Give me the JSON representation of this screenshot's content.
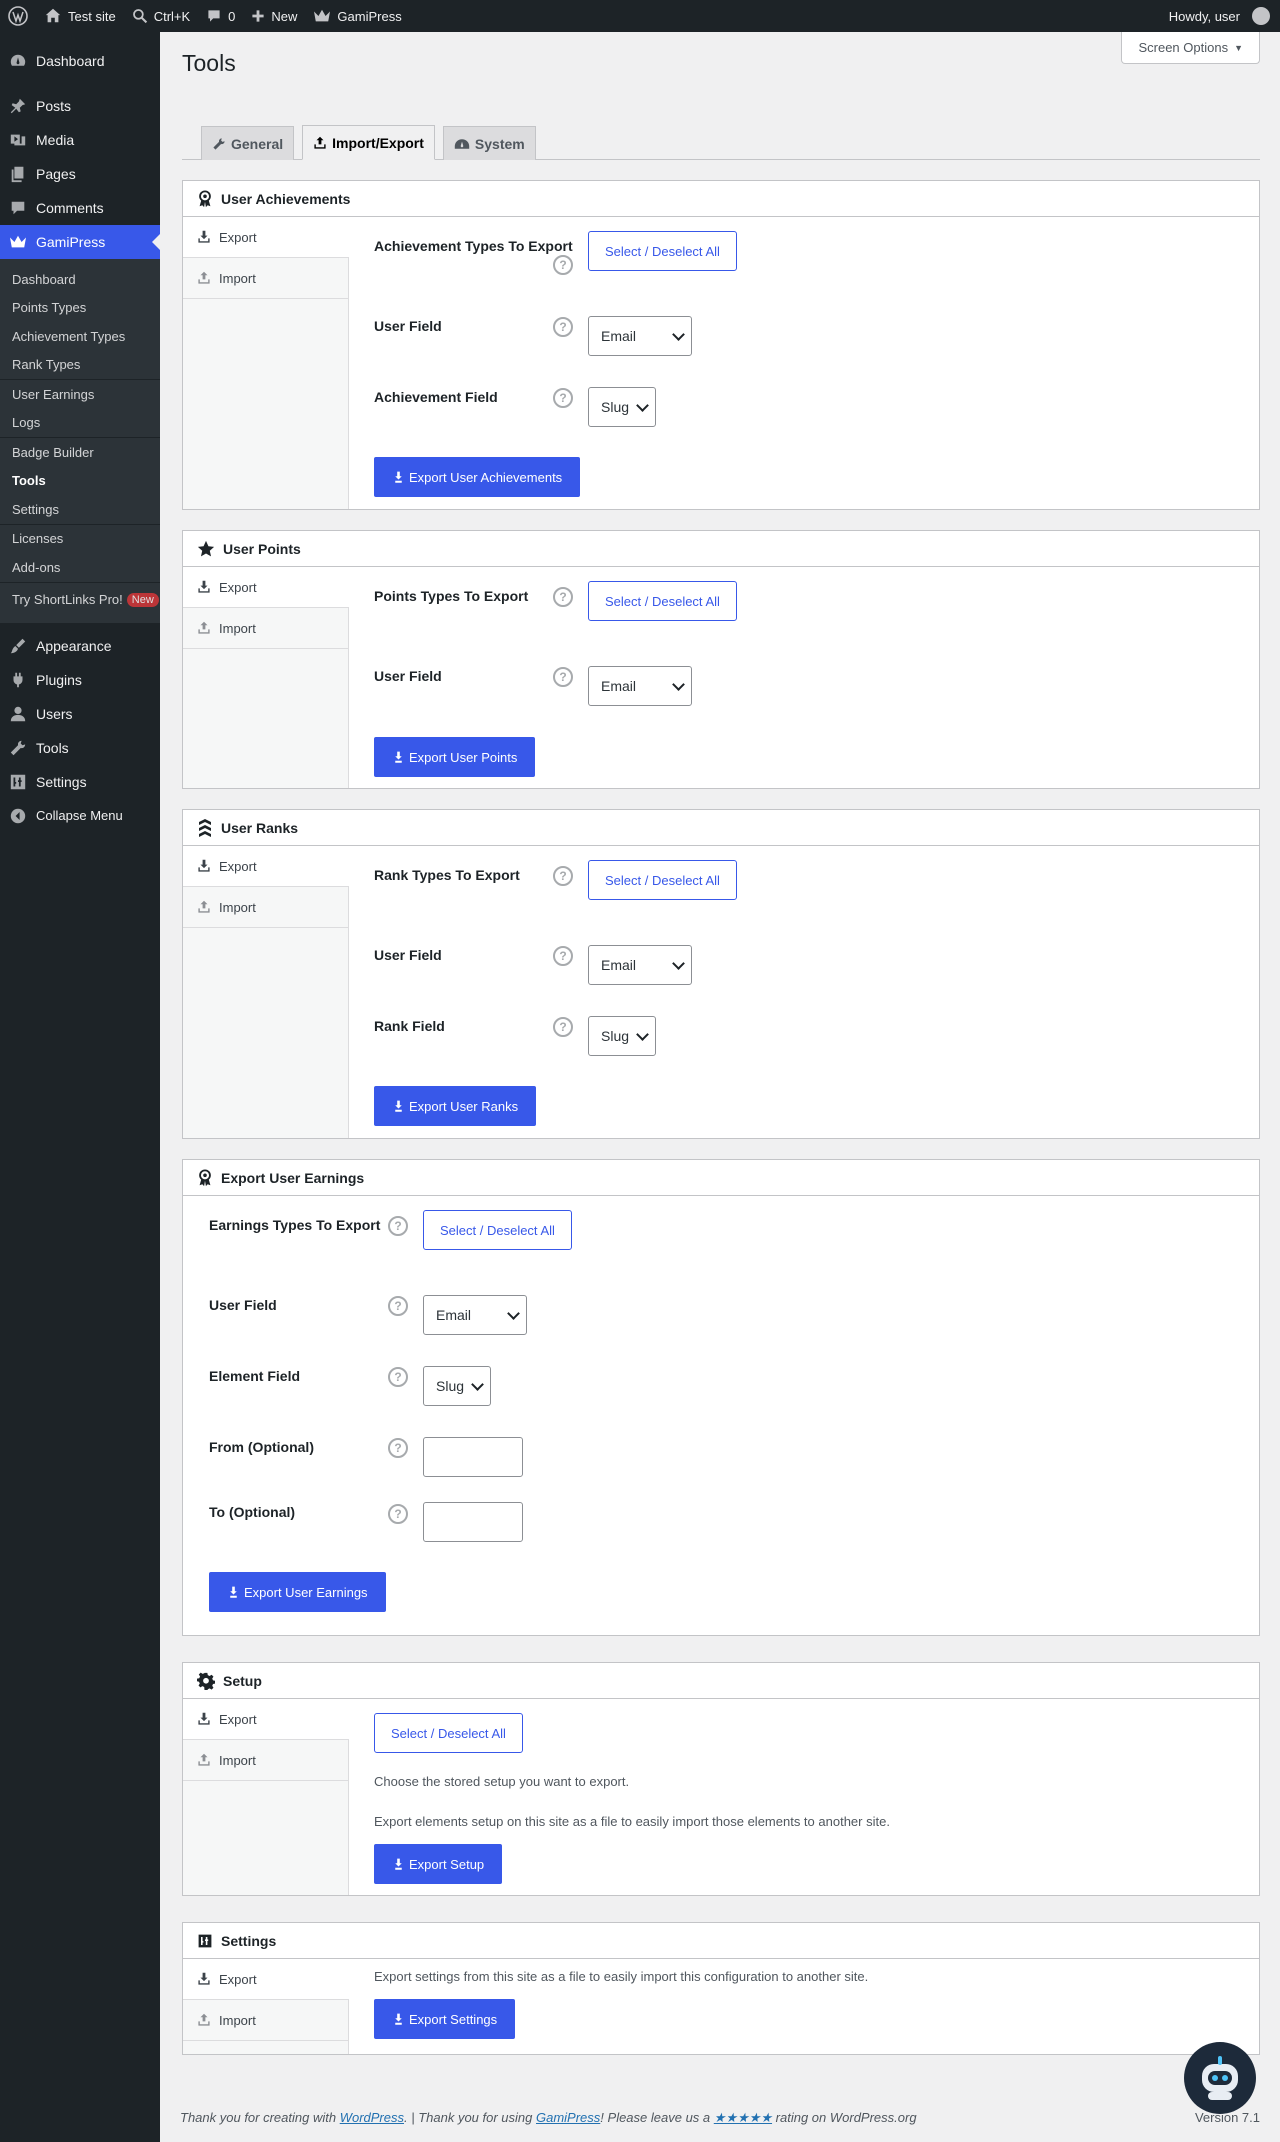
{
  "admin_bar": {
    "site_name": "Test site",
    "search_shortcut": "Ctrl+K",
    "comments_count": "0",
    "new_label": "New",
    "plugin_label": "GamiPress",
    "greeting": "Howdy, user"
  },
  "sidebar": {
    "dashboard": "Dashboard",
    "posts": "Posts",
    "media": "Media",
    "pages": "Pages",
    "comments": "Comments",
    "gamipress": "GamiPress",
    "gamipress_sub": {
      "dashboard": "Dashboard",
      "points_types": "Points Types",
      "achievement_types": "Achievement Types",
      "rank_types": "Rank Types",
      "user_earnings": "User Earnings",
      "logs": "Logs",
      "badge_builder": "Badge Builder",
      "tools": "Tools",
      "settings": "Settings",
      "licenses": "Licenses",
      "add_ons": "Add-ons",
      "try_shortlinks": "Try ShortLinks Pro!",
      "new_badge": "New"
    },
    "appearance": "Appearance",
    "plugins": "Plugins",
    "users": "Users",
    "tools": "Tools",
    "settings": "Settings",
    "collapse": "Collapse Menu"
  },
  "page": {
    "title": "Tools",
    "screen_options": "Screen Options"
  },
  "tabs": [
    "General",
    "Import/Export",
    "System"
  ],
  "common": {
    "export": "Export",
    "import": "Import",
    "select_deselect": "Select / Deselect All",
    "email": "Email",
    "slug": "Slug",
    "help": "?"
  },
  "user_achievements": {
    "title": "User Achievements",
    "types_label": "Achievement Types To Export",
    "user_field": "User Field",
    "achievement_field": "Achievement Field",
    "button": "Export User Achievements"
  },
  "user_points": {
    "title": "User Points",
    "types_label": "Points Types To Export",
    "user_field": "User Field",
    "button": "Export User Points"
  },
  "user_ranks": {
    "title": "User Ranks",
    "types_label": "Rank Types To Export",
    "user_field": "User Field",
    "rank_field": "Rank Field",
    "button": "Export User Ranks"
  },
  "user_earnings": {
    "title": "Export User Earnings",
    "types_label": "Earnings Types To Export",
    "user_field": "User Field",
    "element_field": "Element Field",
    "from": "From (Optional)",
    "to": "To (Optional)",
    "button": "Export User Earnings"
  },
  "setup": {
    "title": "Setup",
    "choose_text": "Choose the stored setup you want to export.",
    "desc": "Export elements setup on this site as a file to easily import those elements to another site.",
    "button": "Export Setup"
  },
  "settings_box": {
    "title": "Settings",
    "desc": "Export settings from this site as a file to easily import this configuration to another site.",
    "button": "Export Settings"
  },
  "footer": {
    "prefix": "Thank you for creating with ",
    "wp_link": "WordPress",
    "middle": ". | Thank you for using ",
    "gp_link": "GamiPress",
    "rating_pre": "! Please leave us a ",
    "stars": "★★★★★",
    "rating_post": " rating on WordPress.org",
    "version": "Version 7.1"
  }
}
